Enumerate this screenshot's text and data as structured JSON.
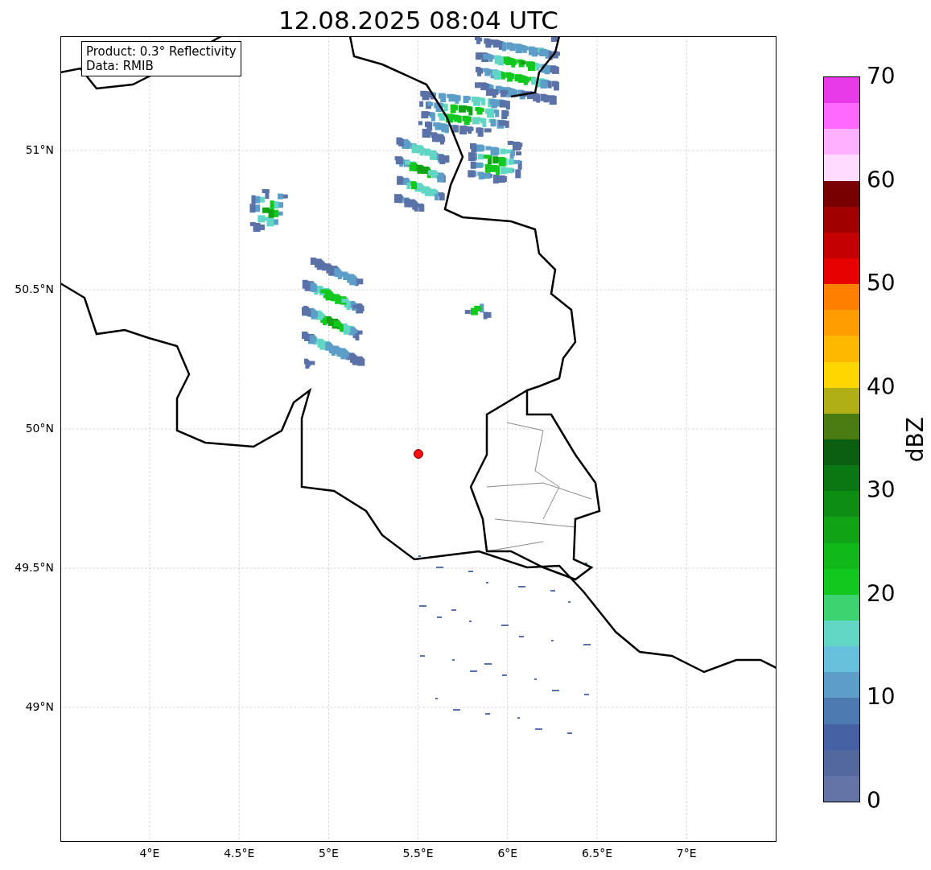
{
  "title": "12.08.2025 08:04 UTC",
  "info_box": {
    "lines": [
      "Product: 0.3° Reflectivity",
      "Data: RMIB"
    ]
  },
  "map": {
    "x_ticks": [
      "4°E",
      "4.5°E",
      "5°E",
      "5.5°E",
      "6°E",
      "6.5°E",
      "7°E"
    ],
    "y_ticks": [
      "51°N",
      "50.5°N",
      "50°N",
      "49.5°N",
      "49°N"
    ]
  },
  "colorbar": {
    "label": "dBZ",
    "ticks": [
      "70",
      "60",
      "50",
      "40",
      "30",
      "20",
      "10",
      "0"
    ],
    "bins": [
      {
        "color": "#6474a6"
      },
      {
        "color": "#53689f"
      },
      {
        "color": "#4560a3"
      },
      {
        "color": "#4d7ab0"
      },
      {
        "color": "#5c9ec8"
      },
      {
        "color": "#66c0dc"
      },
      {
        "color": "#62d6c4"
      },
      {
        "color": "#3bd470"
      },
      {
        "color": "#12c81f"
      },
      {
        "color": "#10b81a"
      },
      {
        "color": "#10a315"
      },
      {
        "color": "#0e8d14"
      },
      {
        "color": "#0b7713"
      },
      {
        "color": "#0a5e0f"
      },
      {
        "color": "#4a7a12"
      },
      {
        "color": "#b0b016"
      },
      {
        "color": "#ffd600"
      },
      {
        "color": "#ffb800"
      },
      {
        "color": "#ff9c00"
      },
      {
        "color": "#ff7f00"
      },
      {
        "color": "#e60000"
      },
      {
        "color": "#c40000"
      },
      {
        "color": "#a00000"
      },
      {
        "color": "#780000"
      },
      {
        "color": "#ffdcff"
      },
      {
        "color": "#ffb0ff"
      },
      {
        "color": "#ff69ff"
      },
      {
        "color": "#e83ae8"
      }
    ]
  }
}
